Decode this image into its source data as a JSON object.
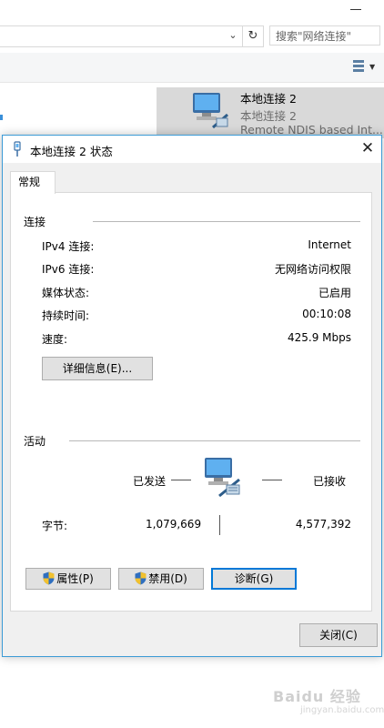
{
  "explorer": {
    "search_placeholder": "搜索\"网络连接\"",
    "refresh_glyph": "↻",
    "chevron_glyph": "⌄",
    "adapter": {
      "name": "本地连接 2",
      "subtitle": "本地连接 2",
      "description": "Remote NDIS based Int..."
    }
  },
  "dialog": {
    "title": "本地连接 2 状态",
    "close_glyph": "✕",
    "tab": "常规",
    "connection": {
      "heading": "连接",
      "rows": [
        {
          "label": "IPv4 连接:",
          "value": "Internet"
        },
        {
          "label": "IPv6 连接:",
          "value": "无网络访问权限"
        },
        {
          "label": "媒体状态:",
          "value": "已启用"
        },
        {
          "label": "持续时间:",
          "value": "00:10:08"
        },
        {
          "label": "速度:",
          "value": "425.9 Mbps"
        }
      ],
      "details_button": "详细信息(E)..."
    },
    "activity": {
      "heading": "活动",
      "sent_label": "已发送",
      "received_label": "已接收",
      "bytes_label": "字节:",
      "bytes_sent": "1,079,669",
      "bytes_received": "4,577,392"
    },
    "buttons": {
      "properties": "属性(P)",
      "disable": "禁用(D)",
      "diagnose": "诊断(G)",
      "close": "关闭(C)"
    }
  },
  "watermark": {
    "text": "Baidu 经验",
    "sub": "jingyan.baidu.com"
  },
  "colors": {
    "accent": "#0078d7",
    "dialog_border": "#3c9bd6",
    "button_face": "#e1e1e1"
  }
}
